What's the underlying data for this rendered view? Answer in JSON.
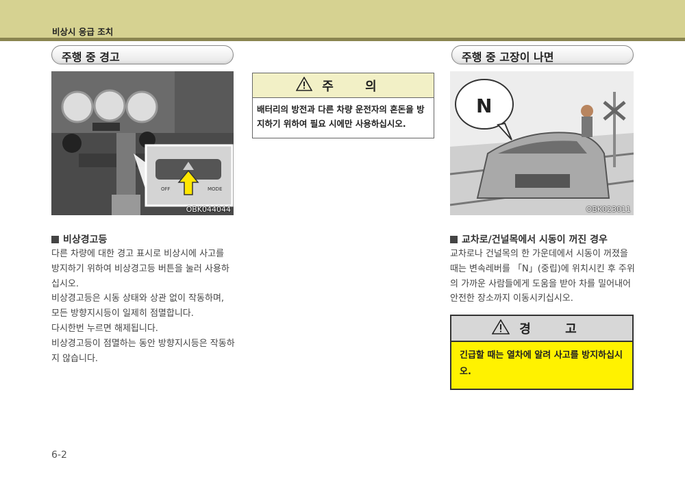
{
  "header": {
    "title": "비상시 응급 조치"
  },
  "left": {
    "section_title": "주행 중 경고",
    "photo_code": "OBK044044",
    "subhead": "비상경고등",
    "paragraphs": [
      "다른 차량에 대한 경고 표시로 비상시에 사고를 방지하기 위하여 비상경고등 버튼을 눌러 사용하십시오.",
      "비상경고등은 시동 상태와 상관 없이 작동하며, 모든 방향지시등이 일제히 점멸합니다.",
      "다시한번 누르면 해제됩니다.",
      "비상경고등이 점멸하는 동안 방향지시등은 작동하지 않습니다."
    ],
    "photo_labels": {
      "off": "OFF",
      "mode": "MODE"
    }
  },
  "middle": {
    "caution_title": "주 의",
    "caution_text": "배터리의 방전과 다른 차량 운전자의 혼돈을 방지하기 위하여 필요 시에만 사용하십시오."
  },
  "right": {
    "section_title": "주행 중 고장이 나면",
    "photo_code": "OBK023011",
    "bubble_letter": "N",
    "subhead": "교차로/건널목에서 시동이 꺼진 경우",
    "paragraph": "교차로나 건널목의 한 가운데에서 시동이 꺼졌을 때는 변속레버를 「N」(중립)에 위치시킨 후 주위의 가까운 사람들에게 도움을 받아 차를 밀어내어 안전한 장소까지 이동시키십시오.",
    "warning_title": "경 고",
    "warning_text": "긴급할 때는 열차에 알려 사고를 방지하십시오."
  },
  "footer": {
    "page": "6-2"
  }
}
